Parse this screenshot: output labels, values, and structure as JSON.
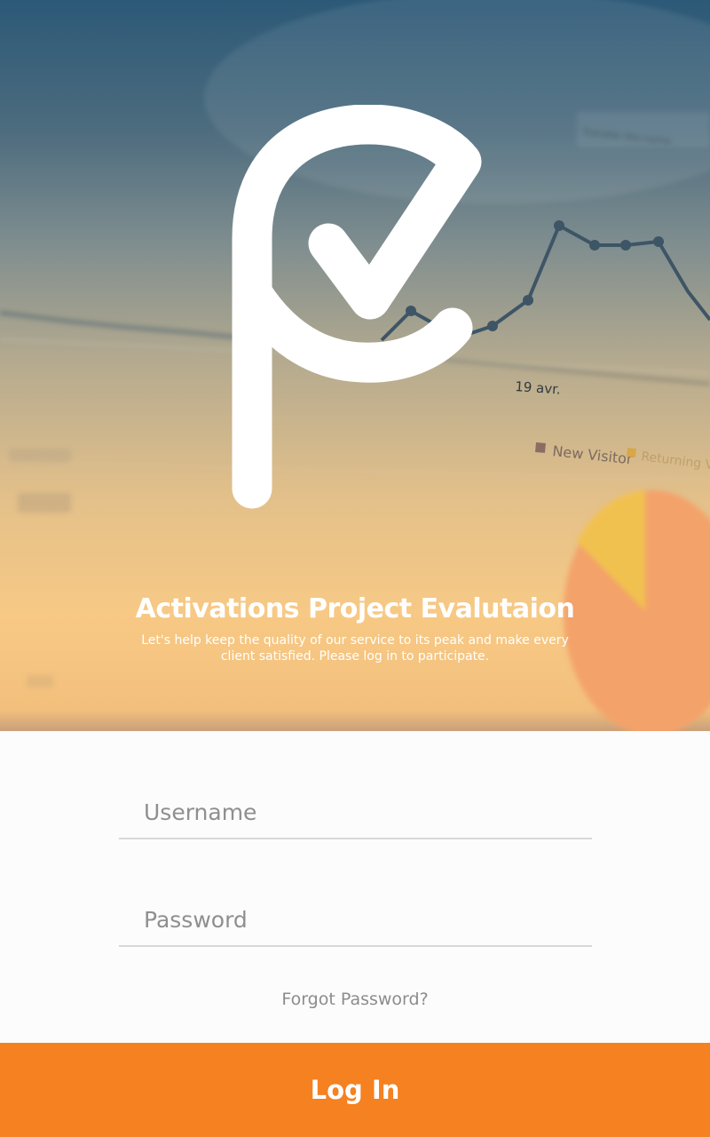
{
  "hero": {
    "background_chart_labels": {
      "date": "19 avr.",
      "legend_new": "New Visitor",
      "legend_returning": "Returning Visitor"
    },
    "app_title": "Activations Project Evalutaion",
    "app_subtitle": "Let's help keep the quality of our service to its peak and make every client satisfied. Please log in to participate."
  },
  "form": {
    "username_placeholder": "Username",
    "password_placeholder": "Password",
    "forgot_password": "Forgot Password?"
  },
  "login_button": "Log In",
  "colors": {
    "accent": "#f58120",
    "title_text": "#ffffff",
    "input_underline": "#d8d8d8",
    "placeholder": "#8f8f8f"
  },
  "icons": {
    "logo": "pe-checkmark-logo"
  }
}
